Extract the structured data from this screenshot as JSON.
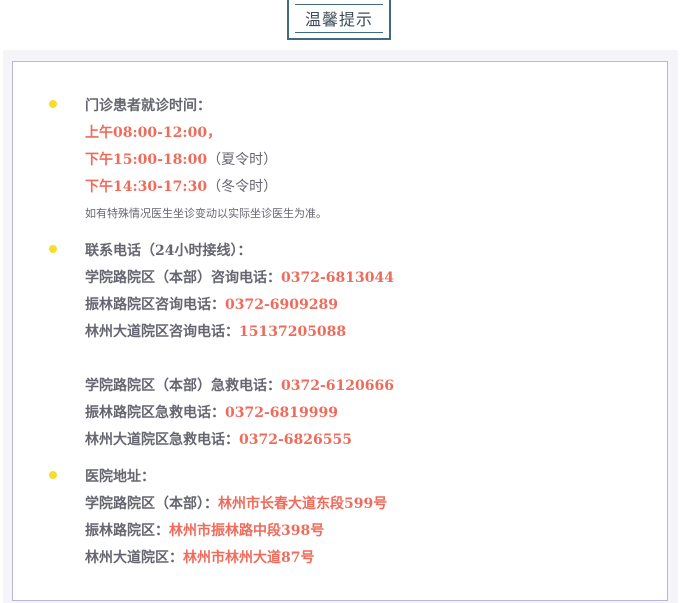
{
  "header": {
    "title": "温馨提示"
  },
  "hours": {
    "heading": "门诊患者就诊时间：",
    "morning": "上午08:00-12:00，",
    "afternoon_summer": "下午15:00-18:00",
    "summer_note": "（夏令时）",
    "afternoon_winter": "下午14:30-17:30",
    "winter_note": "（冬令时）",
    "footnote": "如有特殊情况医生坐诊变动以实际坐诊医生为准。"
  },
  "phones": {
    "heading": "联系电话（24小时接线）：",
    "consult": [
      {
        "label": "学院路院区（本部）咨询电话：",
        "number": "0372-6813044"
      },
      {
        "label": "振林路院区咨询电话：",
        "number": "0372-6909289"
      },
      {
        "label": "林州大道院区咨询电话：",
        "number": "15137205088"
      }
    ],
    "emergency": [
      {
        "label": "学院路院区（本部）急救电话：",
        "number": "0372-6120666"
      },
      {
        "label": "振林路院区急救电话：",
        "number": "0372-6819999"
      },
      {
        "label": "林州大道院区急救电话：",
        "number": "0372-6826555"
      }
    ]
  },
  "address": {
    "heading": "医院地址：",
    "items": [
      {
        "label": "学院路院区（本部）：",
        "value": "林州市长春大道东段599号"
      },
      {
        "label": "振林路院区：",
        "value": "林州市振林路中段398号"
      },
      {
        "label": "林州大道院区：",
        "value": "林州市林州大道87号"
      }
    ]
  },
  "colors": {
    "accent": "#ef6b5b",
    "bullet": "#f6dd2c",
    "border": "#b9b5dc",
    "badge": "#3f6c80"
  }
}
